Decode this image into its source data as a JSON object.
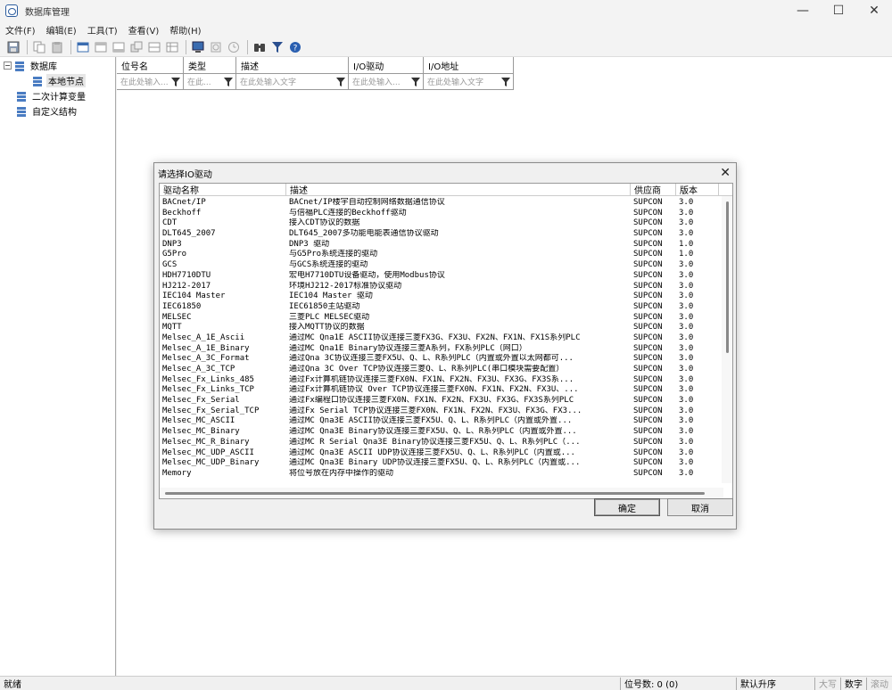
{
  "window": {
    "title": "数据库管理",
    "controls": {
      "minimize": "—",
      "maximize": "☐",
      "close": "✕"
    }
  },
  "menu": [
    "文件(F)",
    "编辑(E)",
    "工具(T)",
    "查看(V)",
    "帮助(H)"
  ],
  "toolbar": {
    "icons": [
      "save-icon",
      "copy-icon",
      "paste-icon",
      "add-icon",
      "import-icon",
      "export-icon",
      "duplicate-icon",
      "sort-icon",
      "table-icon",
      "monitor-icon",
      "refresh-icon",
      "history-icon",
      "binoculars-icon",
      "filter-icon",
      "help-icon"
    ]
  },
  "tree": {
    "items": [
      {
        "label": "数据库",
        "toggle": "−",
        "indent": 0
      },
      {
        "label": "本地节点",
        "indent": 1,
        "selected": true
      },
      {
        "label": "二次计算变量",
        "indent": 0
      },
      {
        "label": "自定义结构",
        "indent": 0
      }
    ]
  },
  "grid": {
    "columns": [
      "位号名",
      "类型",
      "描述",
      "I/O驱动",
      "I/O地址"
    ],
    "filters": [
      "在此处输入...",
      "在此...",
      "在此处输入文字",
      "在此处输入...",
      "在此处输入文字"
    ]
  },
  "dialog": {
    "title": "请选择IO驱动",
    "close": "✕",
    "columns": [
      "驱动名称",
      "描述",
      "供应商",
      "版本"
    ],
    "rows": [
      [
        "BACnet/IP",
        "BACnet/IP楼宇自动控制网络数据通信协议",
        "SUPCON",
        "3.0"
      ],
      [
        "Beckhoff",
        "与倍福PLC连接的Beckhoff驱动",
        "SUPCON",
        "3.0"
      ],
      [
        "CDT",
        "接入CDT协议的数据",
        "SUPCON",
        "3.0"
      ],
      [
        "DLT645_2007",
        "DLT645_2007多功能电能表通信协议驱动",
        "SUPCON",
        "3.0"
      ],
      [
        "DNP3",
        "DNP3 驱动",
        "SUPCON",
        "1.0"
      ],
      [
        "G5Pro",
        "与G5Pro系统连接的驱动",
        "SUPCON",
        "1.0"
      ],
      [
        "GCS",
        "与GCS系统连接的驱动",
        "SUPCON",
        "3.0"
      ],
      [
        "HDH7710DTU",
        "宏电H7710DTU设备驱动，使用Modbus协议",
        "SUPCON",
        "3.0"
      ],
      [
        "HJ212-2017",
        "环境HJ212-2017标准协议驱动",
        "SUPCON",
        "3.0"
      ],
      [
        "IEC104 Master",
        "IEC104 Master 驱动",
        "SUPCON",
        "3.0"
      ],
      [
        "IEC61850",
        "IEC61850主站驱动",
        "SUPCON",
        "3.0"
      ],
      [
        "MELSEC",
        "三菱PLC MELSEC驱动",
        "SUPCON",
        "3.0"
      ],
      [
        "MQTT",
        "接入MQTT协议的数据",
        "SUPCON",
        "3.0"
      ],
      [
        "Melsec_A_1E_Ascii",
        "通过MC Qna1E ASCII协议连接三菱FX3G、FX3U、FX2N、FX1N、FX1S系列PLC",
        "SUPCON",
        "3.0"
      ],
      [
        "Melsec_A_1E_Binary",
        "通过MC Qna1E Binary协议连接三菱A系列，FX系列PLC（网口）",
        "SUPCON",
        "3.0"
      ],
      [
        "Melsec_A_3C_Format",
        "通过Qna 3C协议连接三菱FX5U、Q、L、R系列PLC（内置或外置以太网都可...",
        "SUPCON",
        "3.0"
      ],
      [
        "Melsec_A_3C_TCP",
        "通过Qna 3C Over TCP协议连接三菱Q、L、R系列PLC(串口模块需要配置）",
        "SUPCON",
        "3.0"
      ],
      [
        "Melsec_Fx_Links_485",
        "通过Fx计算机链协议连接三菱FX0N、FX1N、FX2N、FX3U、FX3G、FX3S系...",
        "SUPCON",
        "3.0"
      ],
      [
        "Melsec_Fx_Links_TCP",
        "通过Fx计算机链协议 Over TCP协议连接三菱FX0N、FX1N、FX2N、FX3U、...",
        "SUPCON",
        "3.0"
      ],
      [
        "Melsec_Fx_Serial",
        "通过Fx编程口协议连接三菱FX0N、FX1N、FX2N、FX3U、FX3G、FX3S系列PLC",
        "SUPCON",
        "3.0"
      ],
      [
        "Melsec_Fx_Serial_TCP",
        "通过Fx Serial TCP协议连接三菱FX0N、FX1N、FX2N、FX3U、FX3G、FX3...",
        "SUPCON",
        "3.0"
      ],
      [
        "Melsec_MC_ASCII",
        "通过MC Qna3E ASCII协议连接三菱FX5U、Q、L、R系列PLC（内置或外置...",
        "SUPCON",
        "3.0"
      ],
      [
        "Melsec_MC_Binary",
        "通过MC Qna3E Binary协议连接三菱FX5U、Q、L、R系列PLC（内置或外置...",
        "SUPCON",
        "3.0"
      ],
      [
        "Melsec_MC_R_Binary",
        "通过MC R Serial Qna3E Binary协议连接三菱FX5U、Q、L、R系列PLC（...",
        "SUPCON",
        "3.0"
      ],
      [
        "Melsec_MC_UDP_ASCII",
        "通过MC Qna3E ASCII UDP协议连接三菱FX5U、Q、L、R系列PLC（内置或...",
        "SUPCON",
        "3.0"
      ],
      [
        "Melsec_MC_UDP_Binary",
        "通过MC Qna3E Binary UDP协议连接三菱FX5U、Q、L、R系列PLC（内置或...",
        "SUPCON",
        "3.0"
      ],
      [
        "Memory",
        "将位号放在内存中操作的驱动",
        "SUPCON",
        "3.0"
      ]
    ],
    "ok_label": "确定",
    "cancel_label": "取消"
  },
  "status": {
    "ready": "就绪",
    "count": "位号数: 0 (0)",
    "sort": "默认升序",
    "caps": "大写",
    "num": "数字",
    "scroll": "滚动"
  }
}
